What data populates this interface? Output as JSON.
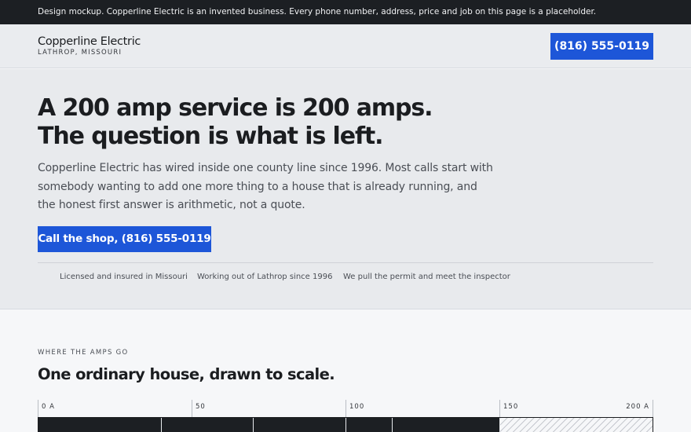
{
  "notice": "Design mockup. Copperline Electric is an invented business. Every phone number, address, price and job on this page is a placeholder.",
  "brand": {
    "name": "Copperline Electric",
    "location": "LATHROP, MISSOURI"
  },
  "header": {
    "phone_label": "(816) 555-0119"
  },
  "hero": {
    "headline_line1": "A 200 amp service is 200 amps.",
    "headline_line2": "The question is what is left.",
    "lede": "Copperline Electric has wired inside one county line since 1996. Most calls start with somebody wanting to add one more thing to a house that is already running, and the honest first answer is arithmetic, not a quote.",
    "cta_label": "Call the shop, (816) 555-0119",
    "trust_items": [
      "Licensed and insured in Missouri",
      "Working out of Lathrop since 1996",
      "We pull the permit and meet the inspector"
    ]
  },
  "amps": {
    "eyebrow": "WHERE THE AMPS GO",
    "title": "One ordinary house, drawn to scale.",
    "scale": {
      "max": 200,
      "ticks": [
        {
          "value": 0,
          "label": "0 A"
        },
        {
          "value": 50,
          "label": "50"
        },
        {
          "value": 100,
          "label": "100"
        },
        {
          "value": 150,
          "label": "150"
        },
        {
          "value": 200,
          "label": "200 A"
        }
      ],
      "segment_ends": [
        40,
        70,
        100,
        115,
        150
      ],
      "spare_start": 150
    }
  },
  "colors": {
    "accent": "#1d56d8",
    "dark": "#1c1f23",
    "hero_bg": "#e8eaed"
  }
}
